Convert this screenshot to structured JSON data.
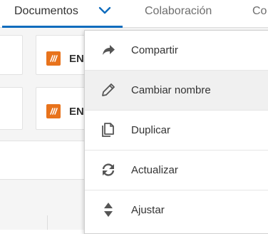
{
  "tabs": [
    {
      "label": "Documentos",
      "active": true
    },
    {
      "label": "Colaboración",
      "active": false
    },
    {
      "label": "Co",
      "active": false
    }
  ],
  "cards": [
    {
      "title": "EN",
      "icon": "solidworks-logo-icon"
    },
    {
      "title": "EN",
      "icon": "solidworks-logo-icon"
    }
  ],
  "menu": {
    "items": [
      {
        "label": "Compartir",
        "icon": "share-arrow-icon"
      },
      {
        "label": "Cambiar nombre",
        "icon": "pencil-icon",
        "hovered": true
      },
      {
        "label": "Duplicar",
        "icon": "duplicate-icon"
      },
      {
        "label": "Actualizar",
        "icon": "refresh-icon"
      },
      {
        "label": "Ajustar",
        "icon": "sort-arrows-icon"
      }
    ]
  },
  "colors": {
    "accent": "#0f6cbd",
    "logo": "#e8731c",
    "hover": "#f0f0f0"
  }
}
